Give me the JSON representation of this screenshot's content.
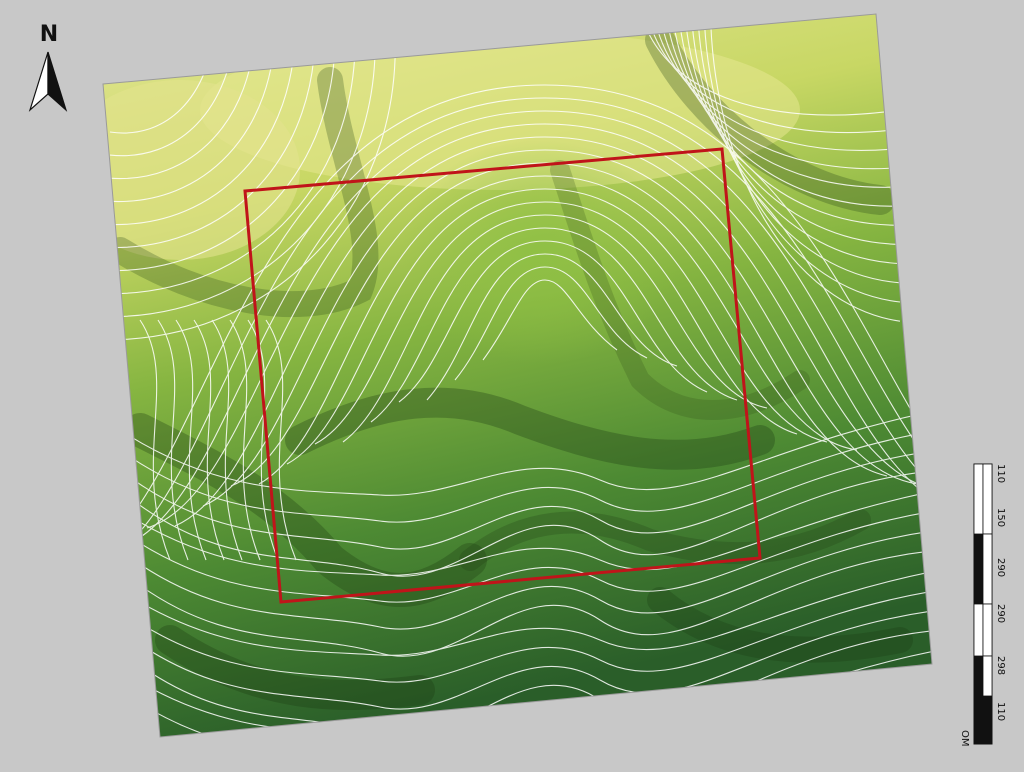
{
  "map": {
    "north_label": "N",
    "scale": {
      "labels": [
        "110",
        "150",
        "290",
        "290",
        "298",
        "110"
      ],
      "unit": "OM"
    },
    "colors": {
      "background": "#c8c8c8",
      "study_area_outline": "#c0141a",
      "contour": "#ffffff",
      "terrain_high": "#dfe48a",
      "terrain_mid": "#7fb03e",
      "terrain_low": "#2f6a2c"
    },
    "layers": [
      "hillshade-terrain",
      "contour-lines",
      "study-area-boundary"
    ]
  }
}
